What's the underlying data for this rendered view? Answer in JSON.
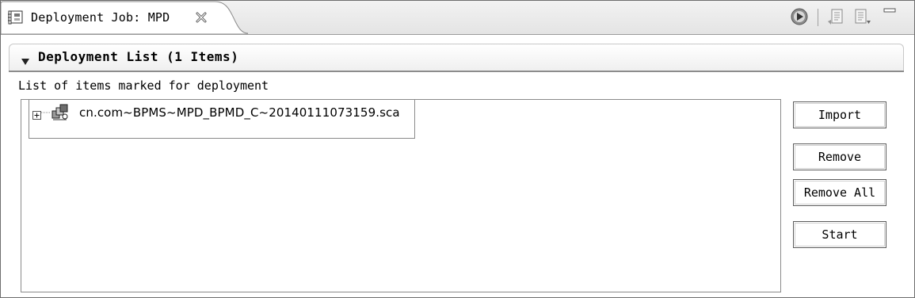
{
  "tab": {
    "title": "Deployment Job: MPD",
    "icon": "deployment-job-icon",
    "close_icon": "close-icon"
  },
  "toolbar": {
    "icons": [
      "run-icon",
      "view-menu-icon",
      "page-icon",
      "minimize-icon"
    ]
  },
  "section": {
    "title": "Deployment List (1 Items)",
    "expanded": true
  },
  "list": {
    "label": "List of items marked for deployment",
    "items": [
      {
        "text": "cn.com~BPMS~MPD_BPMD_C~20140111073159.sca",
        "icon": "package-icon",
        "expanded": false
      }
    ]
  },
  "buttons": {
    "import": "Import",
    "remove": "Remove",
    "remove_all": "Remove All",
    "start": "Start"
  }
}
